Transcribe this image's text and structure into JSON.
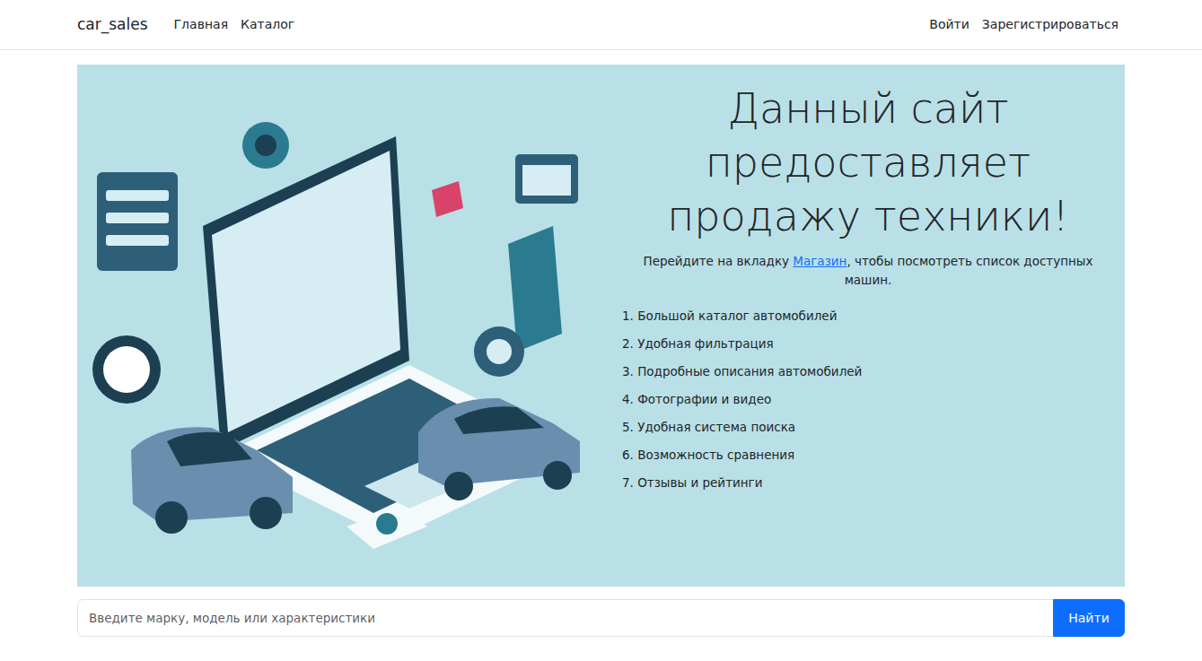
{
  "navbar": {
    "brand": "car_sales",
    "links": [
      {
        "label": "Главная",
        "selected": false
      },
      {
        "label": "Каталог",
        "selected": false
      }
    ],
    "auth": [
      "Войти",
      "Зарегистрироваться"
    ]
  },
  "hero": {
    "title": "Данный сайт предоставляет продажу техники!",
    "intro_before": "Перейдите на вкладку ",
    "intro_link": "Магазин",
    "intro_after": ", чтобы посмотреть список доступных машин.",
    "features": [
      {
        "number": "1.",
        "text": "Большой каталог автомобилей"
      },
      {
        "number": "2.",
        "text": "Удобная фильтрация"
      },
      {
        "number": "3.",
        "text": "Подробные описания автомобилей"
      },
      {
        "number": "4.",
        "text": "Фотографии и видео"
      },
      {
        "number": "5.",
        "text": "Удобная система поиска"
      },
      {
        "number": "6.",
        "text": "Возможность сравнения"
      },
      {
        "number": "7.",
        "text": "Отзывы и рейтинги"
      }
    ]
  },
  "search": {
    "placeholder": "Введите марку, модель или характеристики",
    "button": "Найти"
  }
}
